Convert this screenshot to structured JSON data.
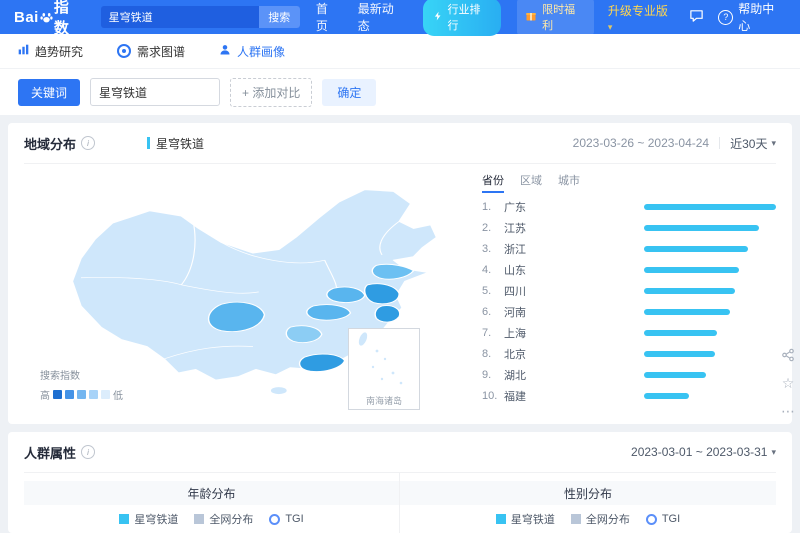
{
  "header": {
    "logo_prefix": "Bai",
    "logo_suffix": "指数",
    "search": {
      "value": "星穹铁道",
      "button": "搜索"
    },
    "nav": [
      {
        "label": "首页"
      },
      {
        "label": "最新动态"
      },
      {
        "label": "行业排行"
      }
    ],
    "promo": "限时福利",
    "upgrade": "升级专业版",
    "help": "帮助中心"
  },
  "subnav": [
    {
      "label": "趋势研究"
    },
    {
      "label": "需求图谱"
    },
    {
      "label": "人群画像"
    }
  ],
  "querybar": {
    "keyword_label": "关键词",
    "keyword_value": "星穹铁道",
    "add_compare": "+ 添加对比",
    "confirm": "确定"
  },
  "region_panel": {
    "title": "地域分布",
    "series_label": "星穹铁道",
    "date_range": "2023-03-26 ~ 2023-04-24",
    "range_select": "近30天",
    "tabs": [
      {
        "label": "省份"
      },
      {
        "label": "区域"
      },
      {
        "label": "城市"
      }
    ],
    "map_legend": {
      "title": "搜索指数",
      "high": "高",
      "low": "低",
      "colors": [
        "#1e6fd0",
        "#4593e6",
        "#74b6f0",
        "#a8d3f8",
        "#dcedfc"
      ]
    },
    "inset_label": "南海诸岛",
    "ranking": [
      {
        "rank": 1,
        "name": "广东",
        "value": 100
      },
      {
        "rank": 2,
        "name": "江苏",
        "value": 87
      },
      {
        "rank": 3,
        "name": "浙江",
        "value": 79
      },
      {
        "rank": 4,
        "name": "山东",
        "value": 72
      },
      {
        "rank": 5,
        "name": "四川",
        "value": 69
      },
      {
        "rank": 6,
        "name": "河南",
        "value": 65
      },
      {
        "rank": 7,
        "name": "上海",
        "value": 55
      },
      {
        "rank": 8,
        "name": "北京",
        "value": 54
      },
      {
        "rank": 9,
        "name": "湖北",
        "value": 47
      },
      {
        "rank": 10,
        "name": "福建",
        "value": 34
      }
    ]
  },
  "audience_panel": {
    "title": "人群属性",
    "date_range": "2023-03-01 ~ 2023-03-31",
    "charts": [
      {
        "title": "年龄分布",
        "legend": [
          "星穹铁道",
          "全网分布",
          "TGI"
        ]
      },
      {
        "title": "性别分布",
        "legend": [
          "星穹铁道",
          "全网分布",
          "TGI"
        ]
      }
    ]
  },
  "colors": {
    "accent_blue": "#2d75f3",
    "bar_cyan": "#38c3f2"
  }
}
